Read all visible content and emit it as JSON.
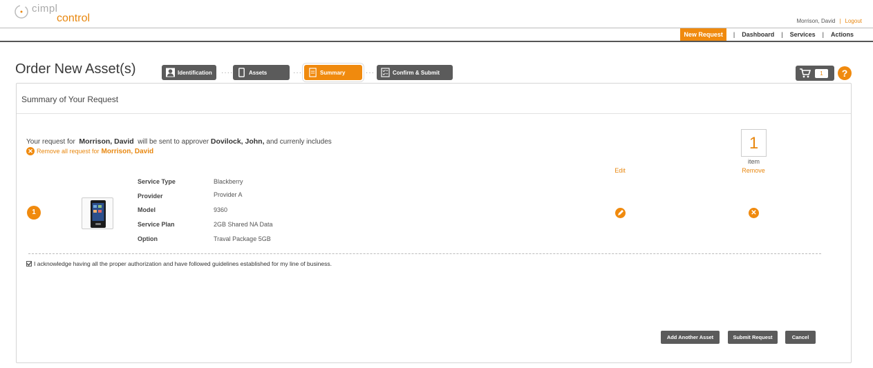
{
  "brand": {
    "line1": "cimpl",
    "line2": "control",
    "accent": "#f08a0e"
  },
  "user": {
    "name": "Morrison, David",
    "logout": "Logout"
  },
  "nav": {
    "items": [
      "New Request",
      "Dashboard",
      "Services",
      "Actions"
    ],
    "active": "New Request"
  },
  "page": {
    "title": "Order New Asset(s)"
  },
  "steps": [
    {
      "label": "Identification",
      "icon": "person-icon"
    },
    {
      "label": "Assets",
      "icon": "phone-icon"
    },
    {
      "label": "Summary",
      "icon": "document-icon",
      "active": true
    },
    {
      "label": "Confirm & Submit",
      "icon": "checklist-icon"
    }
  ],
  "cart": {
    "count": "1",
    "icon": "cart-icon"
  },
  "help": {
    "label": "?"
  },
  "panel": {
    "title": "Summary of Your Request",
    "intro_prefix": "Your request for",
    "requester": "Morrison, David",
    "intro_middle": "will be sent to approver",
    "approver": "Dovilock, John,",
    "intro_suffix": "and currenly includes",
    "remove_all_prefix": "Remove all request for",
    "remove_all_name": "Morrison, David",
    "item_count": "1",
    "item_label": "item",
    "edit_header": "Edit",
    "remove_header": "Remove"
  },
  "asset": {
    "number": "1",
    "specs": [
      {
        "label": "Service Type",
        "value": "Blackberry"
      },
      {
        "label": "Provider",
        "value": "Provider A"
      },
      {
        "label": "Model",
        "value": "9360"
      },
      {
        "label": "Service Plan",
        "value": "2GB Shared NA Data"
      },
      {
        "label": "Option",
        "value": "Traval Package 5GB"
      }
    ]
  },
  "acknowledgement": "I acknowledge having all the proper authorization and have followed guidelines established for my line of business.",
  "buttons": {
    "add": "Add Another Asset",
    "submit": "Submit Request",
    "cancel": "Cancel"
  }
}
